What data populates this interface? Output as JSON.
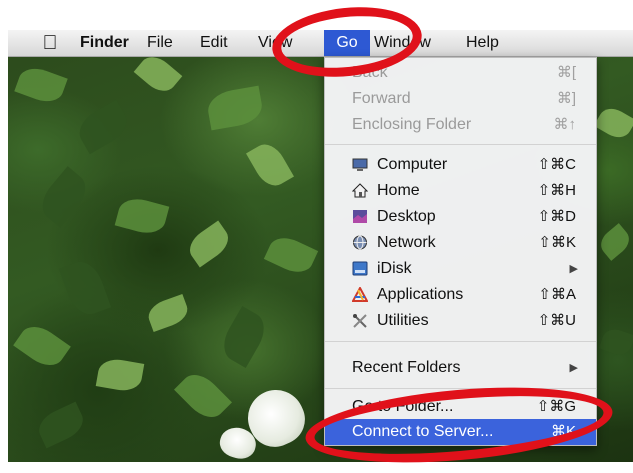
{
  "menubar": {
    "apple": "",
    "items": [
      "Finder",
      "File",
      "Edit",
      "View",
      "Go",
      "Window",
      "Help"
    ]
  },
  "go_menu": {
    "items": [
      {
        "label": "Back",
        "shortcut": "⌘[",
        "enabled": false
      },
      {
        "label": "Forward",
        "shortcut": "⌘]",
        "enabled": false
      },
      {
        "label": "Enclosing Folder",
        "shortcut": "⌘↑",
        "enabled": false
      },
      {
        "label": "Computer",
        "shortcut": "⇧⌘C",
        "icon": "computer-icon"
      },
      {
        "label": "Home",
        "shortcut": "⇧⌘H",
        "icon": "home-icon"
      },
      {
        "label": "Desktop",
        "shortcut": "⇧⌘D",
        "icon": "desktop-icon"
      },
      {
        "label": "Network",
        "shortcut": "⇧⌘K",
        "icon": "network-icon"
      },
      {
        "label": "iDisk",
        "submenu": true,
        "icon": "idisk-icon"
      },
      {
        "label": "Applications",
        "shortcut": "⇧⌘A",
        "icon": "applications-icon"
      },
      {
        "label": "Utilities",
        "shortcut": "⇧⌘U",
        "icon": "utilities-icon"
      },
      {
        "label": "Recent Folders",
        "submenu": true
      },
      {
        "label": "Go to Folder...",
        "shortcut": "⇧⌘G"
      },
      {
        "label": "Connect to Server...",
        "shortcut": "⌘K",
        "selected": true
      }
    ],
    "submenu_glyph": "▶"
  },
  "colors": {
    "menu_highlight": "#3b63dc",
    "annotation_ring": "#e0111a"
  }
}
